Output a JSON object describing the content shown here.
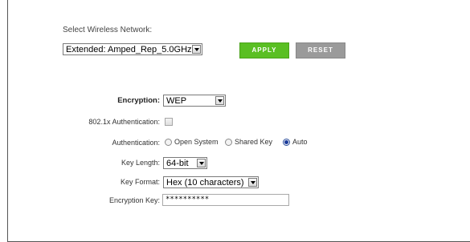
{
  "wireless": {
    "select_label": "Select Wireless Network:",
    "network_value": "Extended: Amped_Rep_5.0GHz"
  },
  "buttons": {
    "apply_label": "APPLY",
    "reset_label": "RESET",
    "apply_color": "#5abf23",
    "reset_color": "#9a9a9a"
  },
  "form": {
    "encryption_label": "Encryption:",
    "encryption_value": "WEP",
    "auth8021x_label": "802.1x Authentication:",
    "auth8021x_checked": false,
    "authentication_label": "Authentication:",
    "auth_options": [
      {
        "label": "Open System",
        "checked": false
      },
      {
        "label": "Shared Key",
        "checked": false
      },
      {
        "label": "Auto",
        "checked": true
      }
    ],
    "key_length_label": "Key Length:",
    "key_length_value": "64-bit",
    "key_format_label": "Key Format:",
    "key_format_value": "Hex (10 characters)",
    "encryption_key_label": "Encryption Key:",
    "encryption_key_value": "**********"
  }
}
